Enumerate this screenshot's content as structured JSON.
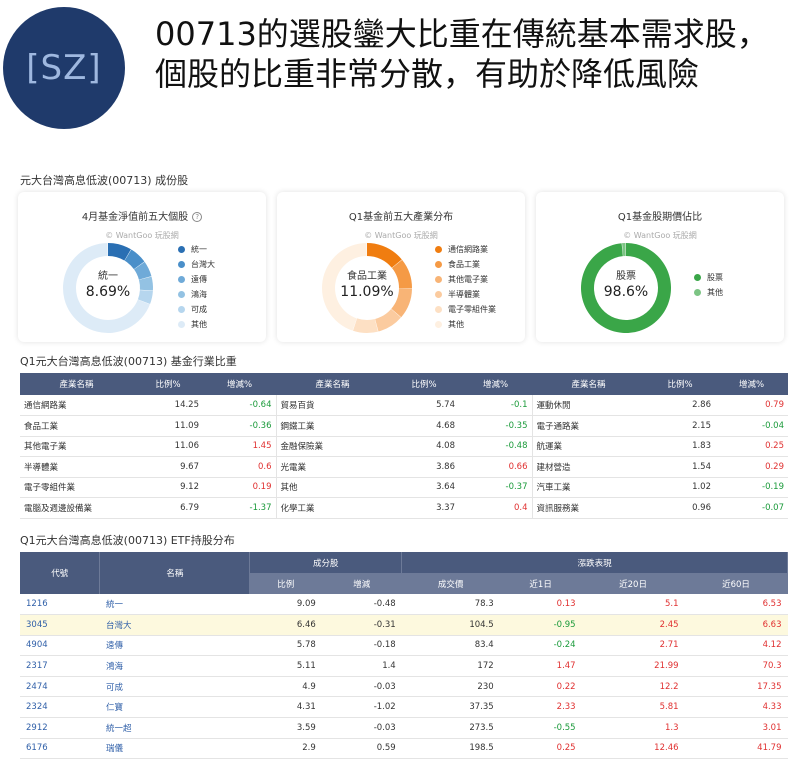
{
  "logo": {
    "text": "[SZ]"
  },
  "headline": "00713的選股鑾大比重在傳統基本需求股，個股的比重非常分散，有助於降低風險",
  "holdings_section_title": "元大台灣高息低波(00713) 成份股",
  "watermark": "© WantGoo 玩股網",
  "cards": [
    {
      "title": "4月基金淨值前五大個股",
      "center_label": "統一",
      "center_value": "8.69%",
      "legend": [
        "統一",
        "台灣大",
        "遠傳",
        "鴻海",
        "可成",
        "其他"
      ],
      "colors": [
        "#2a6fb3",
        "#4a8fc9",
        "#6faad8",
        "#93c2e3",
        "#b6d6ee",
        "#ddebf7"
      ]
    },
    {
      "title": "Q1基金前五大產業分布",
      "center_label": "食品工業",
      "center_value": "11.09%",
      "legend": [
        "通信網路業",
        "食品工業",
        "其他電子業",
        "半導體業",
        "電子零組件業",
        "其他"
      ],
      "colors": [
        "#f07d10",
        "#f59a45",
        "#f8b476",
        "#fbcb9f",
        "#fde0c4",
        "#fef0e1"
      ]
    },
    {
      "title": "Q1基金股期價佔比",
      "center_label": "股票",
      "center_value": "98.6%",
      "legend": [
        "股票",
        "其他"
      ],
      "colors": [
        "#3aa648",
        "#7cc484"
      ]
    }
  ],
  "industry_section_title": "Q1元大台灣高息低波(00713) 基金行業比重",
  "industry_headers": [
    "產業名稱",
    "比例%",
    "增減%"
  ],
  "industry_rows": [
    [
      [
        "通信網路業",
        "14.25",
        "-0.64"
      ],
      [
        "貿易百貨",
        "5.74",
        "-0.1"
      ],
      [
        "運動休閒",
        "2.86",
        "0.79"
      ]
    ],
    [
      [
        "食品工業",
        "11.09",
        "-0.36"
      ],
      [
        "鋼鐵工業",
        "4.68",
        "-0.35"
      ],
      [
        "電子通路業",
        "2.15",
        "-0.04"
      ]
    ],
    [
      [
        "其他電子業",
        "11.06",
        "1.45"
      ],
      [
        "金融保險業",
        "4.08",
        "-0.48"
      ],
      [
        "航運業",
        "1.83",
        "0.25"
      ]
    ],
    [
      [
        "半導體業",
        "9.67",
        "0.6"
      ],
      [
        "光電業",
        "3.86",
        "0.66"
      ],
      [
        "建材營造",
        "1.54",
        "0.29"
      ]
    ],
    [
      [
        "電子零組件業",
        "9.12",
        "0.19"
      ],
      [
        "其他",
        "3.64",
        "-0.37"
      ],
      [
        "汽車工業",
        "1.02",
        "-0.19"
      ]
    ],
    [
      [
        "電腦及週邊設備業",
        "6.79",
        "-1.37"
      ],
      [
        "化學工業",
        "3.37",
        "0.4"
      ],
      [
        "資訊服務業",
        "0.96",
        "-0.07"
      ]
    ]
  ],
  "etf_section_title": "Q1元大台灣高息低波(00713) ETF持股分布",
  "etf_headers": {
    "code": "代號",
    "name": "名稱",
    "group1": "成分股",
    "group2": "漲跌表現",
    "sub": [
      "比例",
      "增減",
      "成交價",
      "近1日",
      "近20日",
      "近60日"
    ]
  },
  "etf_rows": [
    [
      "1216",
      "統一",
      "9.09",
      "-0.48",
      "78.3",
      "0.13",
      "5.1",
      "6.53"
    ],
    [
      "3045",
      "台灣大",
      "6.46",
      "-0.31",
      "104.5",
      "-0.95",
      "2.45",
      "6.63"
    ],
    [
      "4904",
      "遠傳",
      "5.78",
      "-0.18",
      "83.4",
      "-0.24",
      "2.71",
      "4.12"
    ],
    [
      "2317",
      "鴻海",
      "5.11",
      "1.4",
      "172",
      "1.47",
      "21.99",
      "70.3"
    ],
    [
      "2474",
      "可成",
      "4.9",
      "-0.03",
      "230",
      "0.22",
      "12.2",
      "17.35"
    ],
    [
      "2324",
      "仁寶",
      "4.31",
      "-1.02",
      "37.35",
      "2.33",
      "5.81",
      "4.33"
    ],
    [
      "2912",
      "統一超",
      "3.59",
      "-0.03",
      "273.5",
      "-0.55",
      "1.3",
      "3.01"
    ],
    [
      "6176",
      "瑞儀",
      "2.9",
      "0.59",
      "198.5",
      "0.25",
      "12.46",
      "41.79"
    ]
  ],
  "etf_highlight_row": 1
}
